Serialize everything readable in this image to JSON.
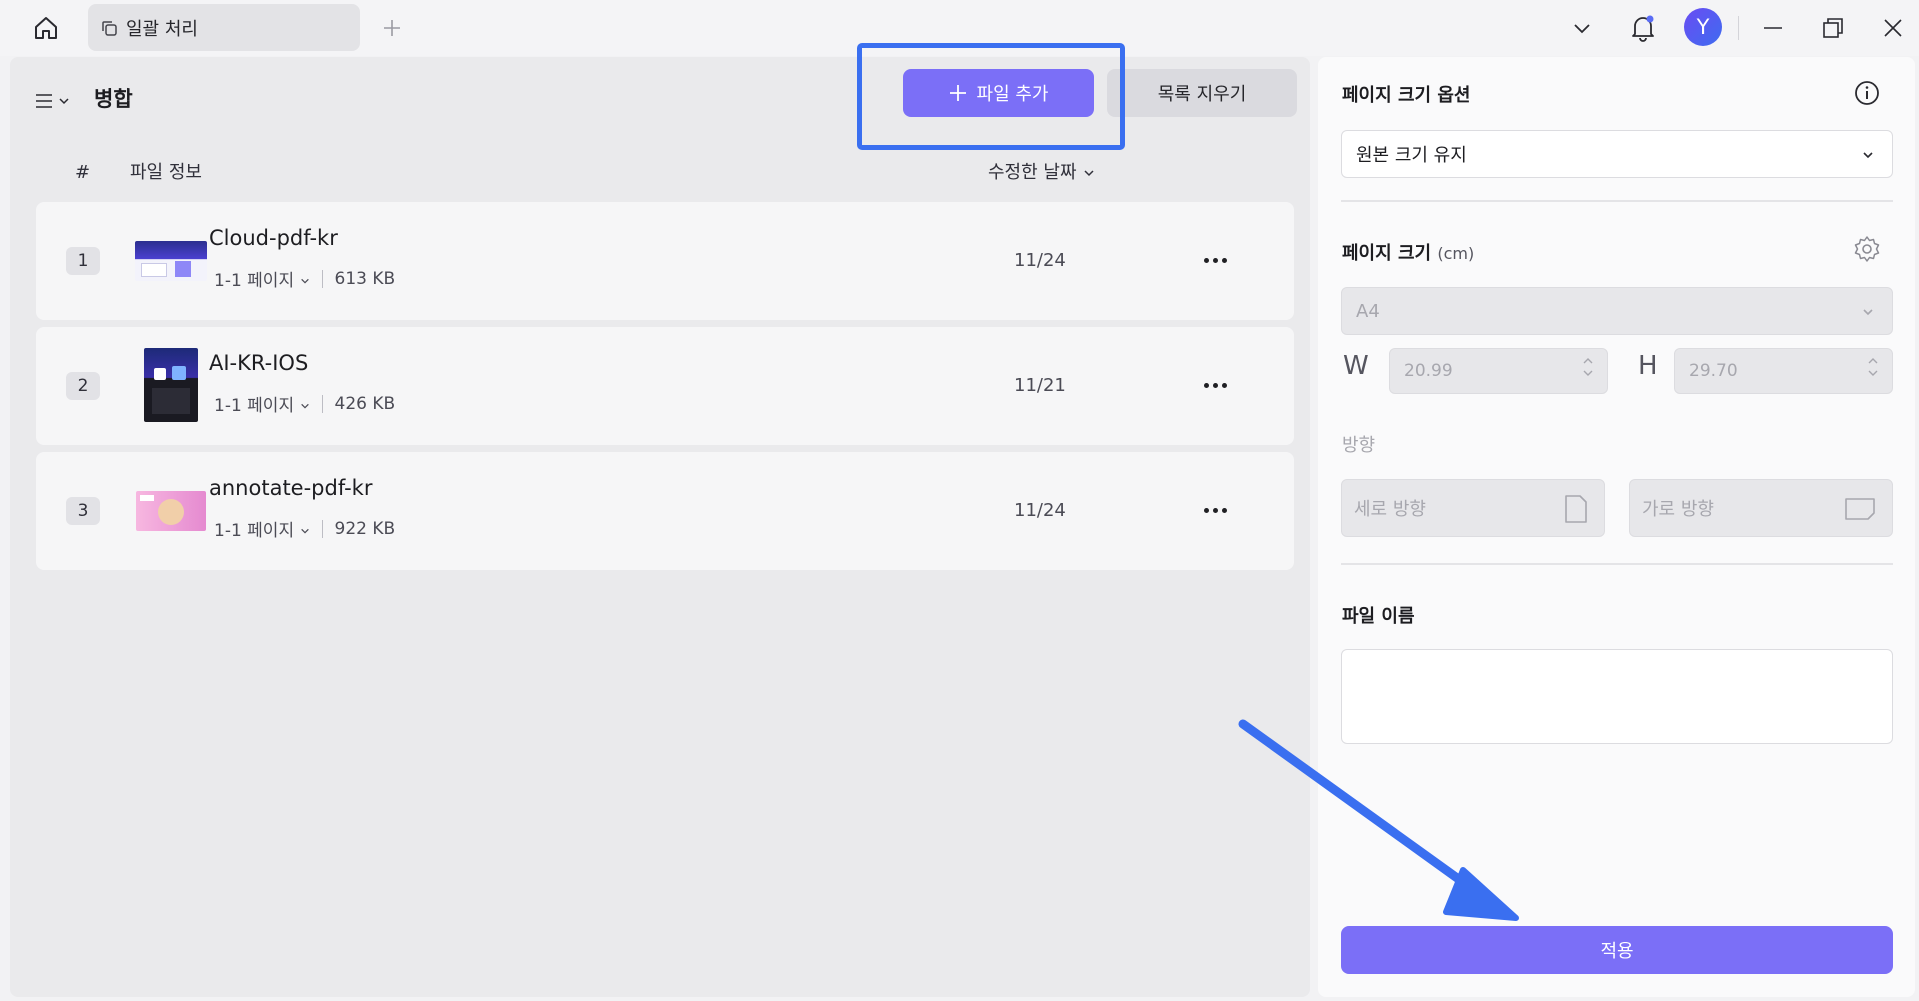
{
  "titlebar": {
    "tab_title": "일괄 처리",
    "avatar_initial": "Y",
    "icons": [
      "home-icon",
      "tab-copy-icon",
      "plus-icon",
      "chevron-down-icon",
      "bell-icon",
      "minimize-icon",
      "restore-icon",
      "close-icon"
    ]
  },
  "left": {
    "title": "병합",
    "add_button": "파일 추가",
    "clear_button": "목록 지우기",
    "columns": {
      "index": "#",
      "info": "파일 정보",
      "date": "수정한 날짜"
    },
    "files": [
      {
        "num": "1",
        "name": "Cloud-pdf-kr",
        "pages": "1-1 페이지",
        "size": "613 KB",
        "date": "11/24"
      },
      {
        "num": "2",
        "name": "AI-KR-IOS",
        "pages": "1-1 페이지",
        "size": "426 KB",
        "date": "11/21"
      },
      {
        "num": "3",
        "name": "annotate-pdf-kr",
        "pages": "1-1 페이지",
        "size": "922 KB",
        "date": "11/24"
      }
    ]
  },
  "right": {
    "size_option_label": "페이지 크기 옵션",
    "size_option_value": "원본 크기 유지",
    "page_size_label": "페이지 크기",
    "page_size_unit": "(cm)",
    "paper_value": "A4",
    "width_label": "W",
    "width_value": "20.99",
    "height_label": "H",
    "height_value": "29.70",
    "orientation_label": "방향",
    "portrait": "세로 방향",
    "landscape": "가로 방향",
    "filename_label": "파일 이름",
    "filename_value": "",
    "apply_button": "적용"
  },
  "colors": {
    "accent": "#7b6ff7",
    "highlight": "#3a6ff0"
  }
}
